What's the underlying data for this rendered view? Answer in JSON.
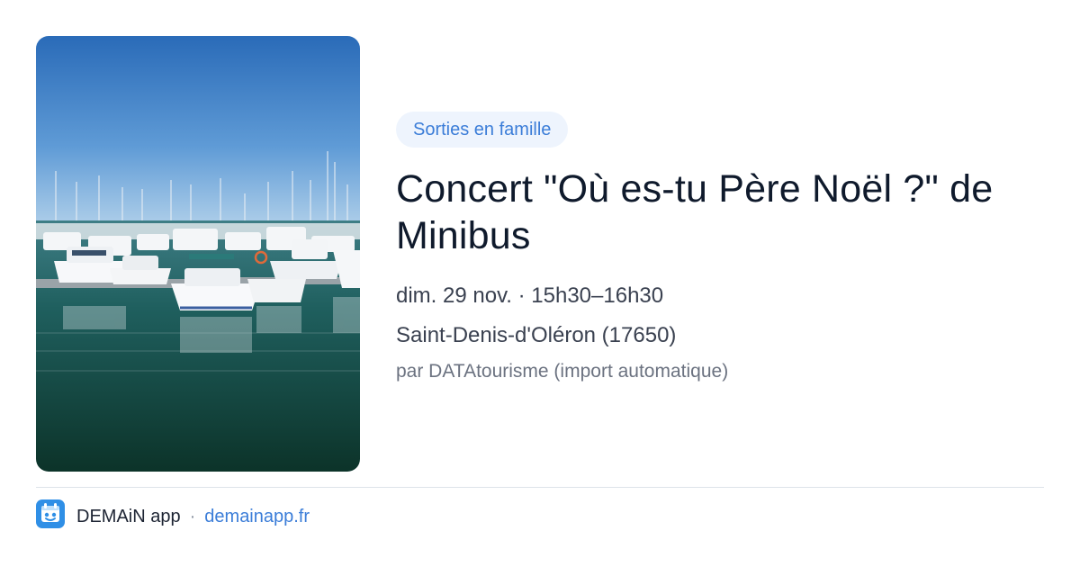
{
  "event": {
    "category_tag": "Sorties en famille",
    "title": "Concert \"Où es-tu Père Noël ?\" de Minibus",
    "date_time": "dim. 29 nov. · 15h30–16h30",
    "location": "Saint-Denis-d'Oléron (17650)",
    "source": "par DATAtourisme (import automatique)"
  },
  "footer": {
    "app_name": "DEMAiN app",
    "separator": "·",
    "domain": "demainapp.fr"
  },
  "colors": {
    "accent": "#3b7dd8",
    "tag_background": "#eef4fd",
    "title_text": "#0f1a2c",
    "divider": "#dde3ea"
  },
  "icons": {
    "logo": "demain-app-logo-icon"
  }
}
